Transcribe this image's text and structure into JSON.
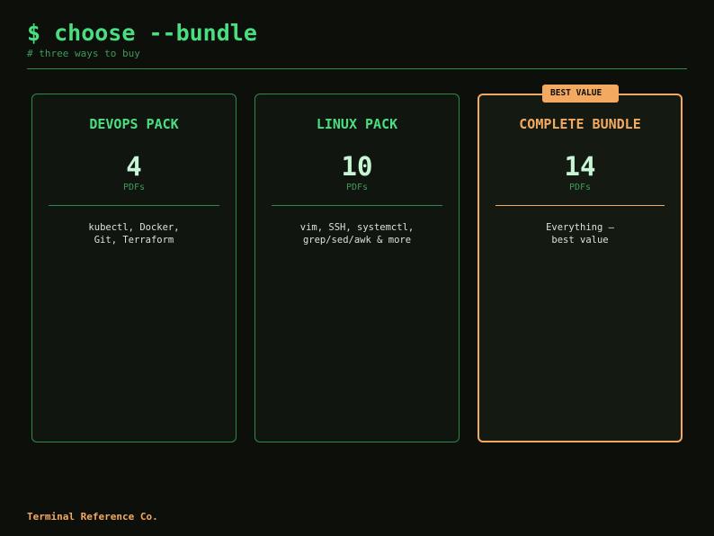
{
  "header": {
    "title": "$ choose --bundle",
    "subtitle": "# three ways to buy"
  },
  "bundles": [
    {
      "name": "DEVOPS PACK",
      "count": "4",
      "unit": "PDFs",
      "description_lines": [
        "kubectl, Docker,",
        "Git, Terraform"
      ],
      "highlighted": false
    },
    {
      "name": "LINUX PACK",
      "count": "10",
      "unit": "PDFs",
      "description_lines": [
        "vim, SSH, systemctl,",
        "grep/sed/awk & more"
      ],
      "highlighted": false
    },
    {
      "name": "COMPLETE BUNDLE",
      "count": "14",
      "unit": "PDFs",
      "description_lines": [
        "Everything —",
        "best value"
      ],
      "highlighted": true,
      "badge": "BEST VALUE"
    }
  ],
  "footer": {
    "brand": "Terminal Reference Co."
  },
  "colors": {
    "background": "#0d0f0b",
    "accent_green": "#4ade80",
    "muted_green": "#3f9a5a",
    "accent_orange": "#f4a961",
    "count_text": "#c6f6d5"
  }
}
